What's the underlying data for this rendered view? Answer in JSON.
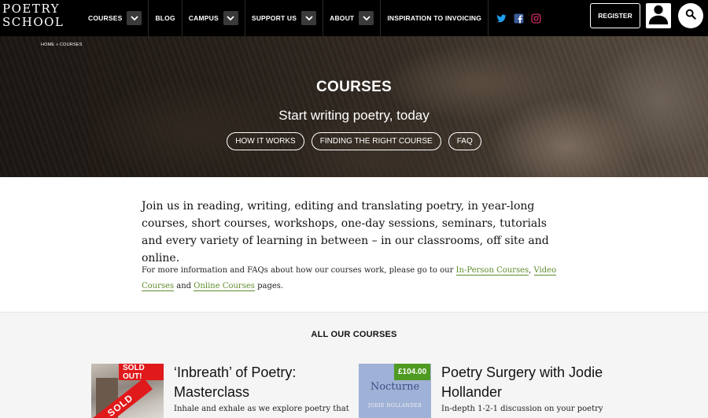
{
  "logo": {
    "line1": "POETRY",
    "line2": "SCHOOL"
  },
  "nav": {
    "items": [
      {
        "label": "COURSES",
        "dropdown": true
      },
      {
        "label": "BLOG",
        "dropdown": false
      },
      {
        "label": "CAMPUS",
        "dropdown": true
      },
      {
        "label": "SUPPORT US",
        "dropdown": true
      },
      {
        "label": "ABOUT",
        "dropdown": true
      },
      {
        "label": "INSPIRATION TO INVOICING",
        "dropdown": false
      }
    ],
    "socials": [
      "twitter-icon",
      "facebook-icon",
      "instagram-icon"
    ],
    "register_label": "REGISTER"
  },
  "breadcrumb": "HOME » COURSES",
  "hero": {
    "title": "COURSES",
    "subtitle": "Start writing poetry, today",
    "buttons": [
      "HOW IT WORKS",
      "FINDING THE RIGHT COURSE",
      "FAQ"
    ]
  },
  "intro": {
    "text": "Join us in reading, writing, editing and translating poetry, in year-long courses, short courses, workshops, one-day sessions, seminars, tutorials and every variety of learning in between – in our classrooms, off site and online.",
    "more_prefix": "For more information and FAQs about how our courses work, please go to our ",
    "link1": "In-Person Courses",
    "sep": ", ",
    "link2": "Video Courses",
    "and": " and ",
    "link3": "Online Courses",
    "suffix": " pages."
  },
  "courses": {
    "heading": "ALL OUR COURSES",
    "cards": [
      {
        "badge": "SOLD OUT!",
        "ribbon": "SOLD",
        "title": "‘Inbreath’ of Poetry: Masterclass",
        "desc": "Inhale and exhale as we explore poetry that"
      },
      {
        "badge": "£104.00",
        "cover_title": "Nocturne",
        "cover_author": "JODIE HOLLANDER",
        "title": "Poetry Surgery with Jodie Hollander",
        "desc": "In-depth 1-2-1 discussion on your poetry"
      }
    ]
  },
  "colors": {
    "accent_green": "#5e8c2b",
    "sold_out_red": "#e0191b",
    "price_green": "#4f9a22",
    "twitter": "#1da1f2",
    "facebook": "#3b5998",
    "instagram": "#e1306c"
  }
}
